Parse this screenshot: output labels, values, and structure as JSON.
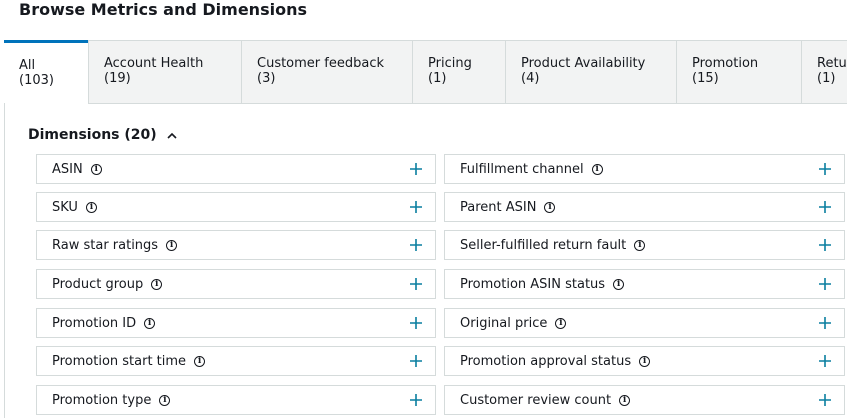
{
  "page_title": "Browse Metrics and Dimensions",
  "tabs": [
    {
      "label": "All",
      "count": "(103)",
      "active": true
    },
    {
      "label": "Account Health",
      "count": "(19)"
    },
    {
      "label": "Customer feedback",
      "count": "(3)"
    },
    {
      "label": "Pricing",
      "count": "(1)"
    },
    {
      "label": "Product Availability",
      "count": "(4)"
    },
    {
      "label": "Promotion",
      "count": "(15)"
    },
    {
      "label": "Retu",
      "count": "(1)"
    }
  ],
  "section": {
    "label": "Dimensions (20)",
    "state_icon": "chevron-up-icon"
  },
  "dimensions_left": [
    "ASIN",
    "SKU",
    "Raw star ratings",
    "Product group",
    "Promotion ID",
    "Promotion start time",
    "Promotion type"
  ],
  "dimensions_right": [
    "Fulfillment channel",
    "Parent ASIN",
    "Seller-fulfilled return fault",
    "Promotion ASIN status",
    "Original price",
    "Promotion approval status",
    "Customer review count"
  ],
  "icons": {
    "info": "info-circle-icon",
    "add": "plus-icon"
  },
  "colors": {
    "accent": "#0073bb",
    "plus": "#0a7fa0",
    "tab_bg": "#f2f3f3",
    "border": "#d5dbdb"
  }
}
